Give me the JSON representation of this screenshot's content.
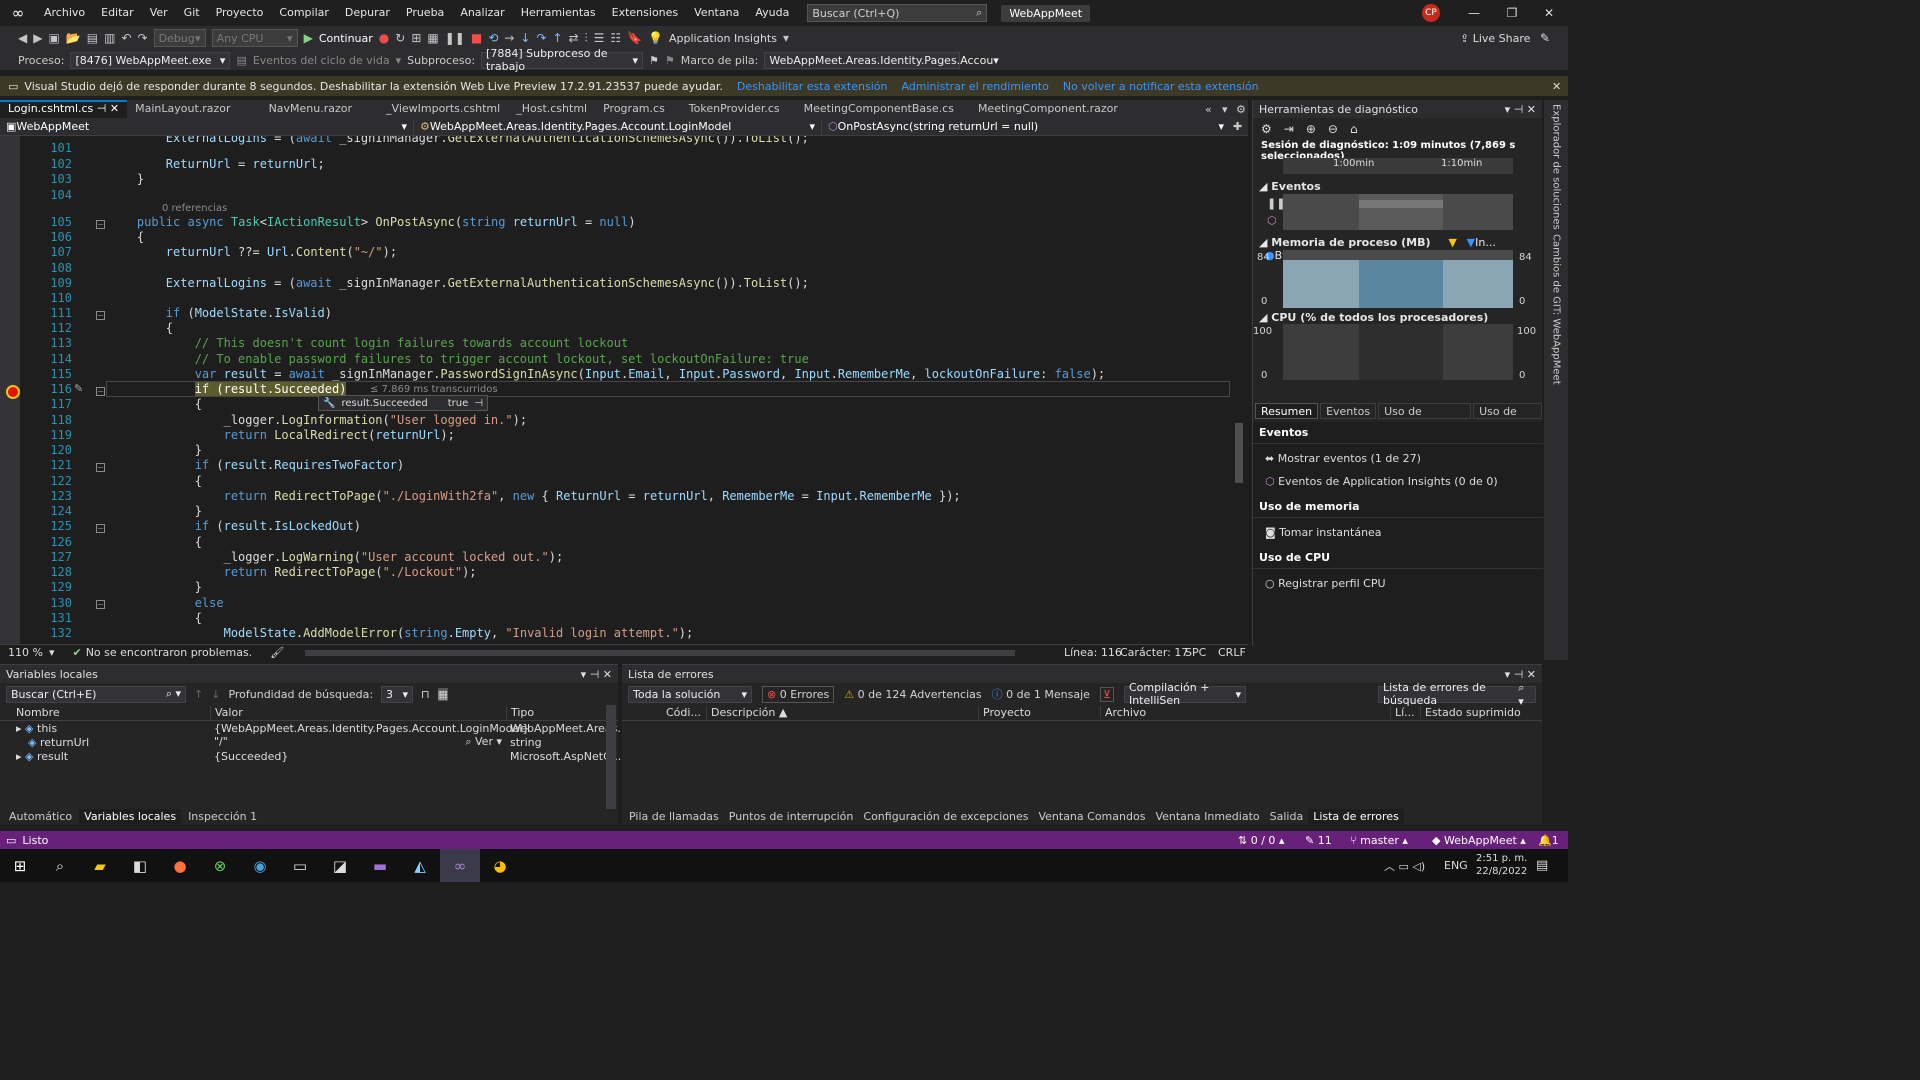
{
  "menu": {
    "items": [
      "Archivo",
      "Editar",
      "Ver",
      "Git",
      "Proyecto",
      "Compilar",
      "Depurar",
      "Prueba",
      "Analizar",
      "Herramientas",
      "Extensiones",
      "Ventana",
      "Ayuda"
    ],
    "search_placeholder": "Buscar (Ctrl+Q)",
    "project_name": "WebAppMeet",
    "avatar": "CP"
  },
  "toolbar": {
    "config": "Debug",
    "platform": "Any CPU",
    "continue": "Continuar",
    "app_insights": "Application Insights",
    "live_share": "Live Share"
  },
  "toolbar2": {
    "process_label": "Proceso:",
    "process": "[8476] WebAppMeet.exe",
    "lifecycle": "Eventos del ciclo de vida",
    "thread_label": "Subproceso:",
    "thread": "[7884] Subproceso de trabajo",
    "stack_label": "Marco de pila:",
    "stack": "WebAppMeet.Areas.Identity.Pages.Accou"
  },
  "infobar": {
    "message": "Visual Studio dejó de responder durante 8 segundos. Deshabilitar la extensión Web Live Preview 17.2.91.23537 puede ayudar.",
    "link1": "Deshabilitar esta extensión",
    "link2": "Administrar el rendimiento",
    "link3": "No volver a notificar esta extensión"
  },
  "tabs": [
    "Login.cshtml.cs",
    "MainLayout.razor",
    "NavMenu.razor",
    "_ViewImports.cshtml",
    "_Host.cshtml",
    "Program.cs",
    "TokenProvider.cs",
    "MeetingComponentBase.cs",
    "MeetingComponent.razor"
  ],
  "nav": {
    "project": "WebAppMeet",
    "class": "WebAppMeet.Areas.Identity.Pages.Account.LoginModel",
    "member": "OnPostAsync(string returnUrl = null)"
  },
  "editor": {
    "line_numbers": [
      "101",
      "102",
      "103",
      "104",
      "105",
      "106",
      "107",
      "108",
      "109",
      "110",
      "111",
      "112",
      "113",
      "114",
      "115",
      "116",
      "117",
      "118",
      "119",
      "120",
      "121",
      "122",
      "123",
      "124",
      "125",
      "126",
      "127",
      "128",
      "129",
      "130",
      "131",
      "132"
    ],
    "refs": "0 referencias",
    "elapsed": "≤ 7.869 ms transcurridos",
    "tooltip_name": "result.Succeeded",
    "tooltip_value": "true"
  },
  "editor_status": {
    "zoom": "110 %",
    "problems": "No se encontraron problemas.",
    "line": "Línea: 116",
    "char": "Carácter: 17",
    "spc": "SPC",
    "crlf": "CRLF"
  },
  "diag": {
    "title": "Herramientas de diagnóstico",
    "session": "Sesión de diagnóstico: 1:09 minutos (7,869 s seleccionados)",
    "t1": "1:00min",
    "t2": "1:10min",
    "events": "Eventos",
    "memory": "Memoria de proceso (MB)",
    "mem_legend1": "In...",
    "mem_legend2": "Byt...",
    "mem_max": "84",
    "mem_min": "0",
    "cpu": "CPU (% de todos los procesadores)",
    "cpu_max": "100",
    "cpu_min": "0",
    "tabs": [
      "Resumen",
      "Eventos",
      "Uso de memoria",
      "Uso de CPU"
    ],
    "sec_events": "Eventos",
    "show_events": "Mostrar eventos (1 de 27)",
    "ai_events": "Eventos de Application Insights (0 de 0)",
    "sec_memory": "Uso de memoria",
    "snapshot": "Tomar instantánea",
    "sec_cpu": "Uso de CPU",
    "cpu_profile": "Registrar perfil CPU"
  },
  "side": [
    "Explorador de soluciones",
    "Cambios de GIT: WebAppMeet"
  ],
  "locals": {
    "title": "Variables locales",
    "search": "Buscar (Ctrl+E)",
    "depth_label": "Profundidad de búsqueda:",
    "depth": "3",
    "cols": [
      "Nombre",
      "Valor",
      "Tipo"
    ],
    "rows": [
      {
        "name": "this",
        "value": "{WebAppMeet.Areas.Identity.Pages.Account.LoginModel}",
        "type": "WebAppMeet.Areas...."
      },
      {
        "name": "returnUrl",
        "value": "\"/\"",
        "type": "string",
        "view": "Ver"
      },
      {
        "name": "result",
        "value": "{Succeeded}",
        "type": "Microsoft.AspNetC..."
      }
    ],
    "tabs": [
      "Automático",
      "Variables locales",
      "Inspección 1"
    ]
  },
  "errors": {
    "title": "Lista de errores",
    "scope": "Toda la solución",
    "errors": "0 Errores",
    "warnings": "0 de 124 Advertencias",
    "messages": "0 de 1 Mensaje",
    "build": "Compilación + IntelliSen",
    "search": "Lista de errores de búsqueda",
    "cols": [
      "Códi...",
      "Descripción",
      "Proyecto",
      "Archivo",
      "Lí...",
      "Estado suprimido"
    ],
    "tabs": [
      "Pila de llamadas",
      "Puntos de interrupción",
      "Configuración de excepciones",
      "Ventana Comandos",
      "Ventana Inmediato",
      "Salida",
      "Lista de errores"
    ]
  },
  "status": {
    "ready": "Listo",
    "sync": "0 / 0",
    "edits": "11",
    "branch": "master",
    "repo": "WebAppMeet",
    "notif": "1"
  },
  "taskbar": {
    "lang": "ENG",
    "time": "2:51 p. m.",
    "date": "22/8/2022"
  }
}
